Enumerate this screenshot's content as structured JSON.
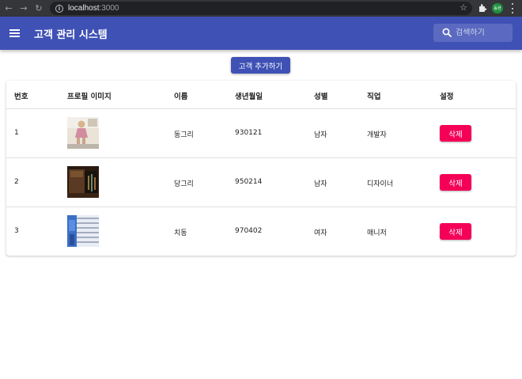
{
  "browser": {
    "url_host": "localhost",
    "url_port": ":3000",
    "profile_label": "동현"
  },
  "appbar": {
    "title": "고객 관리 시스템",
    "search_placeholder": "검색하기"
  },
  "add_button_label": "고객 추가하기",
  "table": {
    "headers": [
      "번호",
      "프로필 이미지",
      "이름",
      "생년월일",
      "성별",
      "직업",
      "설정"
    ],
    "rows": [
      {
        "id": "1",
        "name": "동그리",
        "birthday": "930121",
        "gender": "남자",
        "job": "개발자",
        "action": "삭제"
      },
      {
        "id": "2",
        "name": "당그리",
        "birthday": "950214",
        "gender": "남자",
        "job": "디자이너",
        "action": "삭제"
      },
      {
        "id": "3",
        "name": "치동",
        "birthday": "970402",
        "gender": "여자",
        "job": "매니저",
        "action": "삭제"
      }
    ]
  },
  "colors": {
    "primary": "#3f51b5",
    "secondary": "#f50057"
  }
}
